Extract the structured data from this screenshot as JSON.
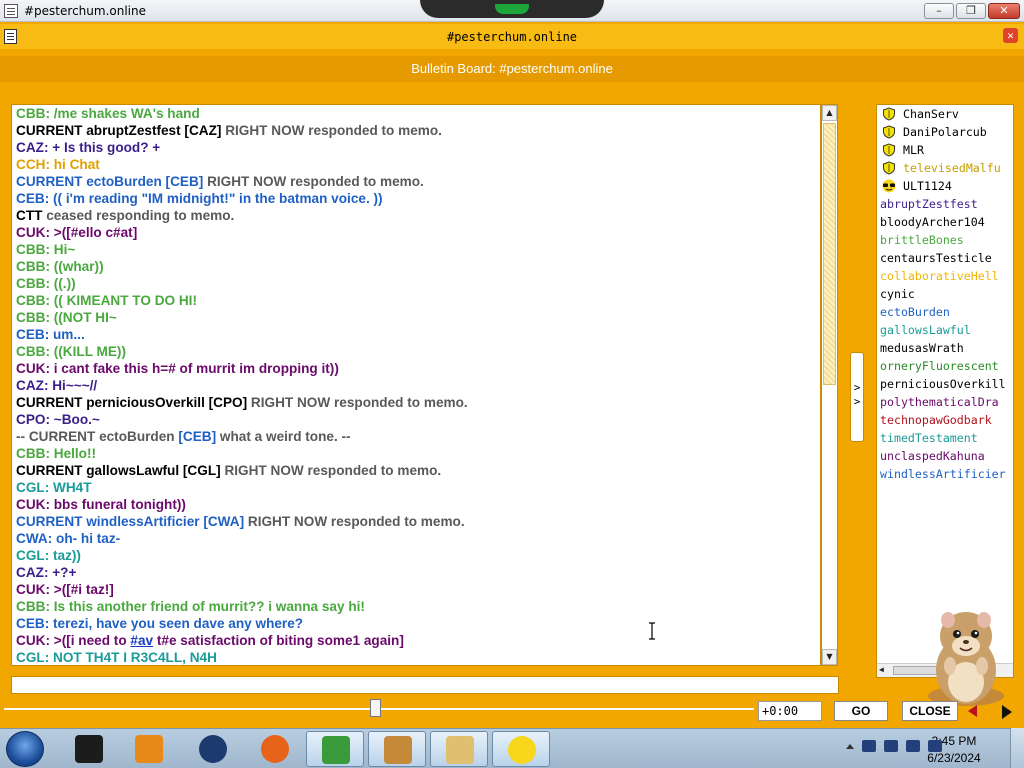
{
  "window": {
    "title": "#pesterchum.online"
  },
  "memo": {
    "title": "#pesterchum.online",
    "bulletin": "Bulletin Board: #pesterchum.online"
  },
  "chat": {
    "lines": [
      {
        "text": "CBB: /me shakes WA's hand",
        "color": "#4aa83f"
      },
      {
        "segments": [
          {
            "t": "CURRENT abruptZestfest [CAZ]",
            "c": "#000000"
          },
          {
            "t": " RIGHT NOW responded to memo.",
            "c": "#595959"
          }
        ]
      },
      {
        "text": "CAZ: + Is this good? +",
        "color": "#3a1f8a"
      },
      {
        "text": "CCH: hi Chat",
        "color": "#e0a100"
      },
      {
        "segments": [
          {
            "t": "CURRENT ectoBurden [CEB]",
            "c": "#1f60c4"
          },
          {
            "t": " RIGHT NOW responded to memo.",
            "c": "#595959"
          }
        ]
      },
      {
        "text": "CEB: (( i'm reading \"IM midnight!\" in the batman voice. ))",
        "color": "#1f60c4"
      },
      {
        "segments": [
          {
            "t": "CTT",
            "c": "#000000"
          },
          {
            "t": " ceased responding to memo.",
            "c": "#595959"
          }
        ]
      },
      {
        "text": "CUK: >([#ello c#at]",
        "color": "#6a0a6a"
      },
      {
        "text": "CBB: Hi~",
        "color": "#4aa83f"
      },
      {
        "text": "CBB: ((whar))",
        "color": "#4aa83f"
      },
      {
        "text": "CBB: ((.))",
        "color": "#4aa83f"
      },
      {
        "text": "CBB: (( KIMEANT TO DO HI!",
        "color": "#4aa83f"
      },
      {
        "text": "CBB: ((NOT HI~",
        "color": "#4aa83f"
      },
      {
        "text": "CEB: um...",
        "color": "#1f60c4"
      },
      {
        "text": "CBB: ((KILL ME))",
        "color": "#4aa83f"
      },
      {
        "text": "CUK: i cant fake this h=# of murrit im dropping it))",
        "color": "#6a0a6a"
      },
      {
        "text": "CAZ: Hi~~~//",
        "color": "#3a1f8a"
      },
      {
        "segments": [
          {
            "t": "CURRENT perniciousOverkill [CPO]",
            "c": "#000000"
          },
          {
            "t": " RIGHT NOW responded to memo.",
            "c": "#595959"
          }
        ]
      },
      {
        "text": "CPO: ~Boo.~",
        "color": "#3a1f8a"
      },
      {
        "segments": [
          {
            "t": "-- CURRENT ectoBurden ",
            "c": "#595959"
          },
          {
            "t": "[CEB]",
            "c": "#1f60c4"
          },
          {
            "t": " what a weird tone. --",
            "c": "#595959"
          }
        ]
      },
      {
        "text": "CBB: Hello!!",
        "color": "#4aa83f"
      },
      {
        "segments": [
          {
            "t": "CURRENT gallowsLawful [CGL]",
            "c": "#000000"
          },
          {
            "t": " RIGHT NOW responded to memo.",
            "c": "#595959"
          }
        ]
      },
      {
        "text": "CGL: WH4T",
        "color": "#1a9c99"
      },
      {
        "text": "CUK: bbs funeral tonight))",
        "color": "#6a0a6a"
      },
      {
        "segments": [
          {
            "t": "CURRENT windlessArtificier [CWA]",
            "c": "#1f60c4"
          },
          {
            "t": " RIGHT NOW responded to memo.",
            "c": "#595959"
          }
        ]
      },
      {
        "text": "CWA: oh- hi taz-",
        "color": "#1f60c4"
      },
      {
        "text": "CGL: taz))",
        "color": "#1a9c99"
      },
      {
        "text": "CAZ: +?+",
        "color": "#3a1f8a"
      },
      {
        "text": "CUK: >([#i taz!]",
        "color": "#6a0a6a"
      },
      {
        "text": "CBB: Is this another friend of murrit?? i wanna say hi!",
        "color": "#4aa83f"
      },
      {
        "text": "CEB: terezi, have you seen dave any where?",
        "color": "#1f60c4"
      },
      {
        "segments": [
          {
            "t": "CUK: >([i need to ",
            "c": "#6a0a6a"
          },
          {
            "t": "#av",
            "c": "#1a3cc2",
            "link": true
          },
          {
            "t": " t#e satisfaction of biting some1 again]",
            "c": "#6a0a6a"
          }
        ]
      },
      {
        "text": "CGL: NOT TH4T I R3C4LL, N4H",
        "color": "#1a9c99"
      }
    ]
  },
  "users": [
    {
      "name": "ChanServ",
      "color": "#000000",
      "icon": "shield-icon"
    },
    {
      "name": "DaniPolarcub",
      "color": "#000000",
      "icon": "shield-icon"
    },
    {
      "name": "MLR",
      "color": "#000000",
      "icon": "shield-icon"
    },
    {
      "name": "televisedMalfu",
      "color": "#c4a000",
      "icon": "shield-icon"
    },
    {
      "name": "ULT1124",
      "color": "#000000",
      "icon": "sunglasses-icon"
    },
    {
      "name": "abruptZestfest",
      "color": "#3a1f8a"
    },
    {
      "name": "bloodyArcher104",
      "color": "#000000"
    },
    {
      "name": "brittleBones",
      "color": "#4aa83f"
    },
    {
      "name": "centaursTesticle",
      "color": "#000000"
    },
    {
      "name": "collaborativeHell",
      "color": "#f0b400"
    },
    {
      "name": "cynic",
      "color": "#000000"
    },
    {
      "name": "ectoBurden",
      "color": "#1f60c4"
    },
    {
      "name": "gallowsLawful",
      "color": "#1a9c99"
    },
    {
      "name": "medusasWrath",
      "color": "#000000"
    },
    {
      "name": "orneryFluorescent",
      "color": "#2a8a2a"
    },
    {
      "name": "perniciousOverkill",
      "color": "#000000"
    },
    {
      "name": "polythematicalDra",
      "color": "#6a0a6a"
    },
    {
      "name": "technopawGodbark",
      "color": "#b0121b"
    },
    {
      "name": "timedTestament",
      "color": "#1a9c99"
    },
    {
      "name": "unclaspedKahuna",
      "color": "#6a0a6a"
    },
    {
      "name": "windlessArtificier",
      "color": "#1f60c4"
    }
  ],
  "collapse_label": ">\n>",
  "controls": {
    "time": "+0:00",
    "go_label": "GO",
    "close_label": "CLOSE"
  },
  "taskbar": {
    "items": [
      {
        "name": "taskbar-item-cube",
        "color": "#1c1c1c"
      },
      {
        "name": "taskbar-item-media-player",
        "color": "#e88a1a"
      },
      {
        "name": "taskbar-item-globe",
        "color": "#1b3a6e"
      },
      {
        "name": "taskbar-item-firefox",
        "color": "#e8631a"
      },
      {
        "name": "taskbar-item-messenger",
        "color": "#3a9b3a"
      },
      {
        "name": "taskbar-item-box-hamster",
        "color": "#c48a3a"
      },
      {
        "name": "taskbar-item-folder",
        "color": "#e0c070"
      },
      {
        "name": "taskbar-item-smiley",
        "color": "#f6d71c"
      }
    ],
    "time": "3:45 PM",
    "date": "6/23/2024"
  }
}
